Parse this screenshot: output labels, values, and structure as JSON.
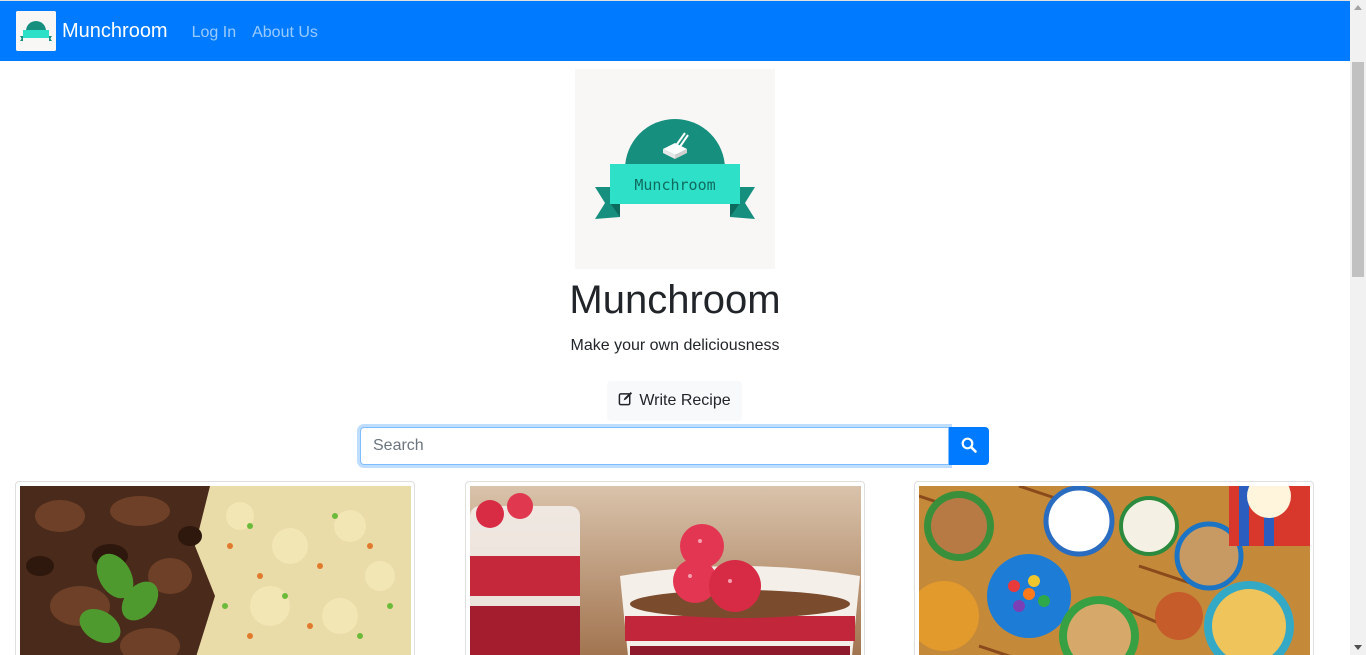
{
  "navbar": {
    "brand": "Munchroom",
    "links": [
      "Log In",
      "About Us"
    ]
  },
  "hero": {
    "logo_text": "Munchroom",
    "title": "Munchroom",
    "subtitle": "Make your own deliciousness"
  },
  "actions": {
    "write_recipe": "Write Recipe"
  },
  "search": {
    "placeholder": "Search",
    "value": ""
  },
  "cards": [
    {
      "image": "stew-with-couscous-photo"
    },
    {
      "image": "raspberry-yogurt-parfait-photo"
    },
    {
      "image": "snack-bowls-photo"
    }
  ],
  "colors": {
    "primary": "#007bff",
    "logo_teal": "#178f7e",
    "logo_ribbon": "#2ee0c8"
  }
}
